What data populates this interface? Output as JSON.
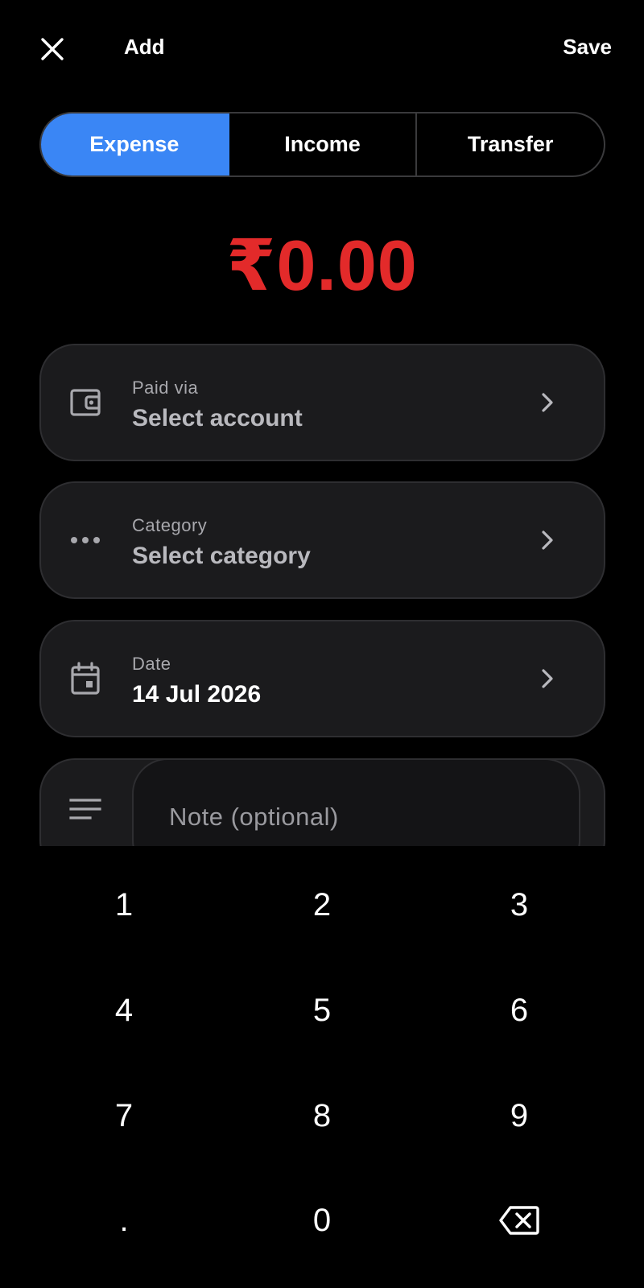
{
  "header": {
    "close_icon": "close-icon",
    "title": "Add",
    "save_label": "Save"
  },
  "type_tabs": [
    {
      "label": "Expense",
      "active": true
    },
    {
      "label": "Income",
      "active": false
    },
    {
      "label": "Transfer",
      "active": false
    }
  ],
  "amount": {
    "display": "₹0.00",
    "color": "#e32a2a"
  },
  "fields": {
    "account": {
      "icon": "wallet-icon",
      "label": "Paid via",
      "value": "Select account"
    },
    "category": {
      "icon": "more-horiz-icon",
      "label": "Category",
      "value": "Select category"
    },
    "date": {
      "icon": "calendar-icon",
      "label": "Date",
      "value": "14 Jul 2026"
    }
  },
  "note": {
    "icon": "notes-icon",
    "placeholder": "Note (optional)",
    "value": ""
  },
  "keypad": {
    "keys": [
      "1",
      "2",
      "3",
      "4",
      "5",
      "6",
      "7",
      "8",
      "9",
      ".",
      "0"
    ],
    "backspace_icon": "backspace-icon"
  },
  "colors": {
    "accent": "#3a86f5",
    "background": "#000000",
    "card": "#1b1b1d",
    "amount_negative": "#e32a2a"
  }
}
